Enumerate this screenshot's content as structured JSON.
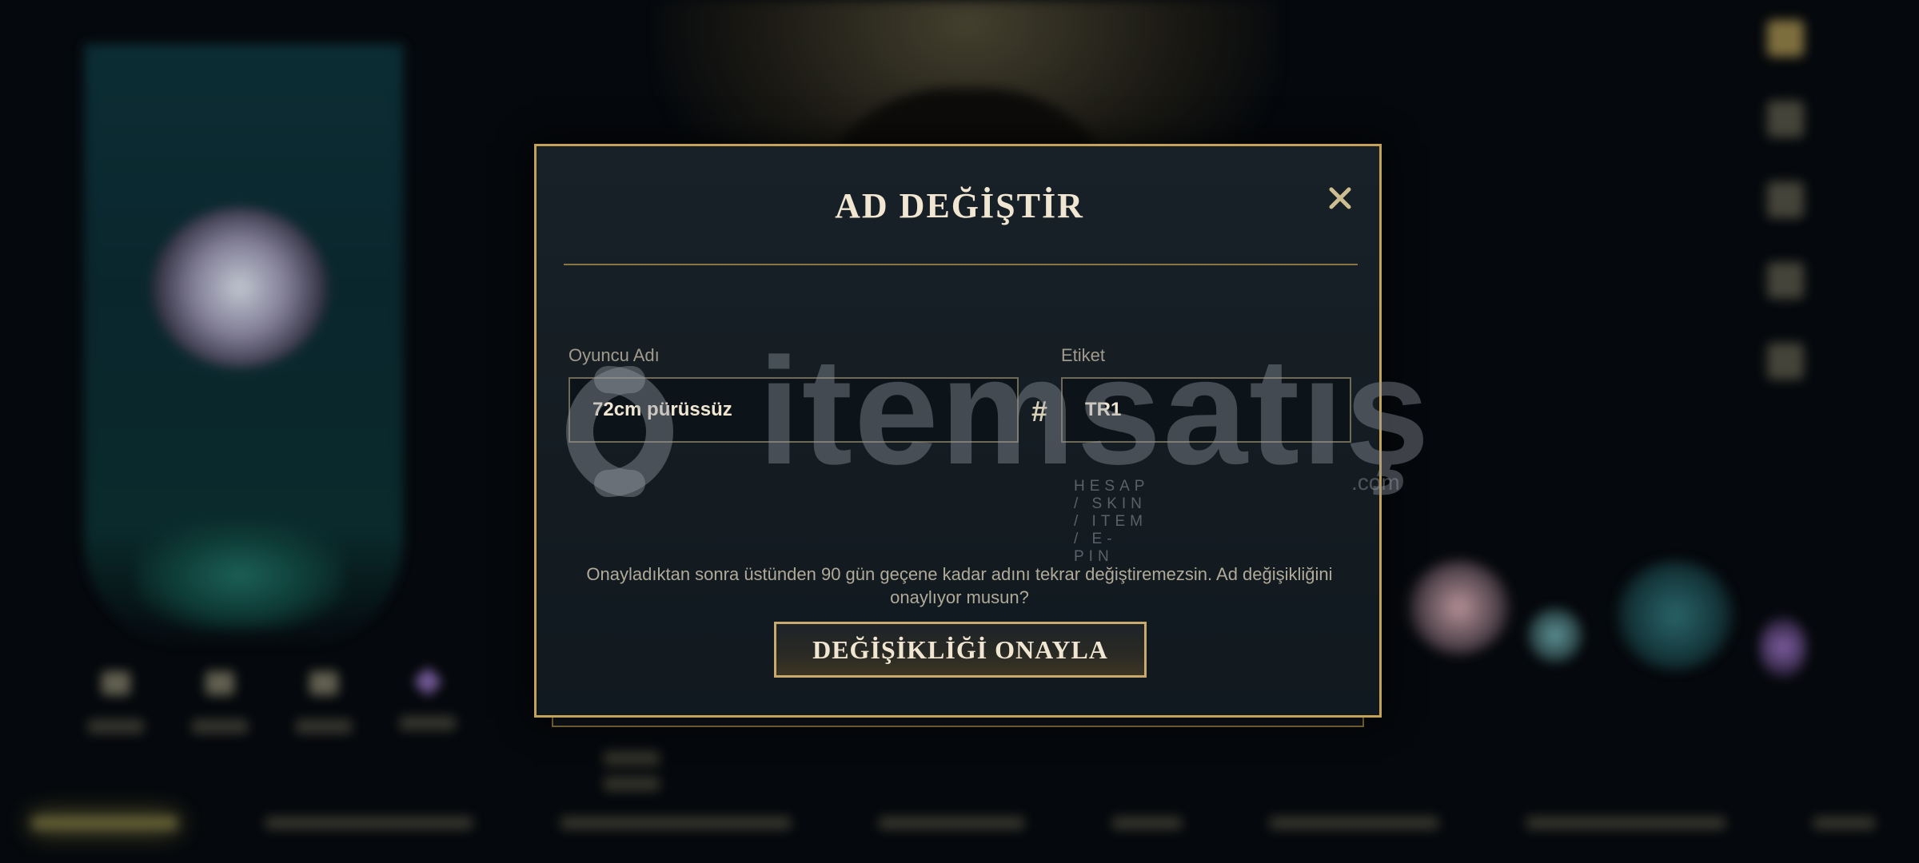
{
  "modal": {
    "title": "AD DEĞİŞTİR",
    "close_icon": "close-icon",
    "player_name_label": "Oyuncu Adı",
    "player_name_value": "72cm pürüssüz",
    "tag_label": "Etiket",
    "tag_value": "TR1",
    "separator": "#",
    "confirmation_text": "Onayladıktan sonra üstünden 90 gün geçene kadar adını tekrar değiştiremezsin. Ad değişikliğini onaylıyor musun?",
    "confirm_button": "DEĞİŞİKLİĞİ ONAYLA"
  },
  "watermark": {
    "brand": "itemsatış",
    "tagline": "HESAP / SKIN / ITEM / E-PIN",
    "domain": ".com"
  },
  "colors": {
    "gold_border": "#c5a25a",
    "modal_bg": "#141c22",
    "title_text": "#f0e6d2",
    "muted_text": "#a09b8c"
  }
}
